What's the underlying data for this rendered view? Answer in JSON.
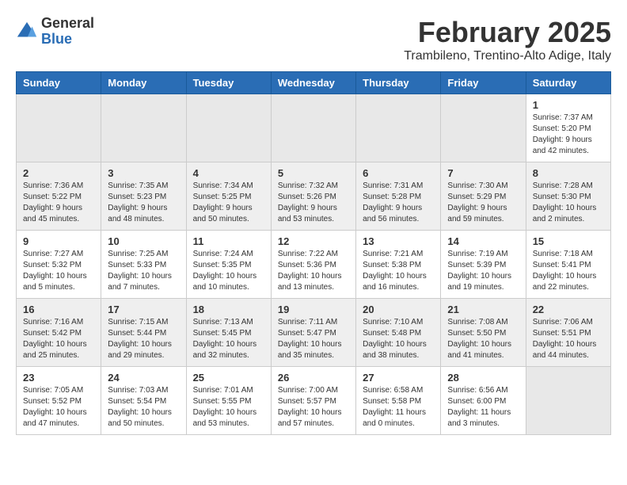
{
  "header": {
    "logo_general": "General",
    "logo_blue": "Blue",
    "month_title": "February 2025",
    "location": "Trambileno, Trentino-Alto Adige, Italy"
  },
  "weekdays": [
    "Sunday",
    "Monday",
    "Tuesday",
    "Wednesday",
    "Thursday",
    "Friday",
    "Saturday"
  ],
  "weeks": [
    [
      {
        "day": "",
        "info": ""
      },
      {
        "day": "",
        "info": ""
      },
      {
        "day": "",
        "info": ""
      },
      {
        "day": "",
        "info": ""
      },
      {
        "day": "",
        "info": ""
      },
      {
        "day": "",
        "info": ""
      },
      {
        "day": "1",
        "info": "Sunrise: 7:37 AM\nSunset: 5:20 PM\nDaylight: 9 hours and 42 minutes."
      }
    ],
    [
      {
        "day": "2",
        "info": "Sunrise: 7:36 AM\nSunset: 5:22 PM\nDaylight: 9 hours and 45 minutes."
      },
      {
        "day": "3",
        "info": "Sunrise: 7:35 AM\nSunset: 5:23 PM\nDaylight: 9 hours and 48 minutes."
      },
      {
        "day": "4",
        "info": "Sunrise: 7:34 AM\nSunset: 5:25 PM\nDaylight: 9 hours and 50 minutes."
      },
      {
        "day": "5",
        "info": "Sunrise: 7:32 AM\nSunset: 5:26 PM\nDaylight: 9 hours and 53 minutes."
      },
      {
        "day": "6",
        "info": "Sunrise: 7:31 AM\nSunset: 5:28 PM\nDaylight: 9 hours and 56 minutes."
      },
      {
        "day": "7",
        "info": "Sunrise: 7:30 AM\nSunset: 5:29 PM\nDaylight: 9 hours and 59 minutes."
      },
      {
        "day": "8",
        "info": "Sunrise: 7:28 AM\nSunset: 5:30 PM\nDaylight: 10 hours and 2 minutes."
      }
    ],
    [
      {
        "day": "9",
        "info": "Sunrise: 7:27 AM\nSunset: 5:32 PM\nDaylight: 10 hours and 5 minutes."
      },
      {
        "day": "10",
        "info": "Sunrise: 7:25 AM\nSunset: 5:33 PM\nDaylight: 10 hours and 7 minutes."
      },
      {
        "day": "11",
        "info": "Sunrise: 7:24 AM\nSunset: 5:35 PM\nDaylight: 10 hours and 10 minutes."
      },
      {
        "day": "12",
        "info": "Sunrise: 7:22 AM\nSunset: 5:36 PM\nDaylight: 10 hours and 13 minutes."
      },
      {
        "day": "13",
        "info": "Sunrise: 7:21 AM\nSunset: 5:38 PM\nDaylight: 10 hours and 16 minutes."
      },
      {
        "day": "14",
        "info": "Sunrise: 7:19 AM\nSunset: 5:39 PM\nDaylight: 10 hours and 19 minutes."
      },
      {
        "day": "15",
        "info": "Sunrise: 7:18 AM\nSunset: 5:41 PM\nDaylight: 10 hours and 22 minutes."
      }
    ],
    [
      {
        "day": "16",
        "info": "Sunrise: 7:16 AM\nSunset: 5:42 PM\nDaylight: 10 hours and 25 minutes."
      },
      {
        "day": "17",
        "info": "Sunrise: 7:15 AM\nSunset: 5:44 PM\nDaylight: 10 hours and 29 minutes."
      },
      {
        "day": "18",
        "info": "Sunrise: 7:13 AM\nSunset: 5:45 PM\nDaylight: 10 hours and 32 minutes."
      },
      {
        "day": "19",
        "info": "Sunrise: 7:11 AM\nSunset: 5:47 PM\nDaylight: 10 hours and 35 minutes."
      },
      {
        "day": "20",
        "info": "Sunrise: 7:10 AM\nSunset: 5:48 PM\nDaylight: 10 hours and 38 minutes."
      },
      {
        "day": "21",
        "info": "Sunrise: 7:08 AM\nSunset: 5:50 PM\nDaylight: 10 hours and 41 minutes."
      },
      {
        "day": "22",
        "info": "Sunrise: 7:06 AM\nSunset: 5:51 PM\nDaylight: 10 hours and 44 minutes."
      }
    ],
    [
      {
        "day": "23",
        "info": "Sunrise: 7:05 AM\nSunset: 5:52 PM\nDaylight: 10 hours and 47 minutes."
      },
      {
        "day": "24",
        "info": "Sunrise: 7:03 AM\nSunset: 5:54 PM\nDaylight: 10 hours and 50 minutes."
      },
      {
        "day": "25",
        "info": "Sunrise: 7:01 AM\nSunset: 5:55 PM\nDaylight: 10 hours and 53 minutes."
      },
      {
        "day": "26",
        "info": "Sunrise: 7:00 AM\nSunset: 5:57 PM\nDaylight: 10 hours and 57 minutes."
      },
      {
        "day": "27",
        "info": "Sunrise: 6:58 AM\nSunset: 5:58 PM\nDaylight: 11 hours and 0 minutes."
      },
      {
        "day": "28",
        "info": "Sunrise: 6:56 AM\nSunset: 6:00 PM\nDaylight: 11 hours and 3 minutes."
      },
      {
        "day": "",
        "info": ""
      }
    ]
  ]
}
